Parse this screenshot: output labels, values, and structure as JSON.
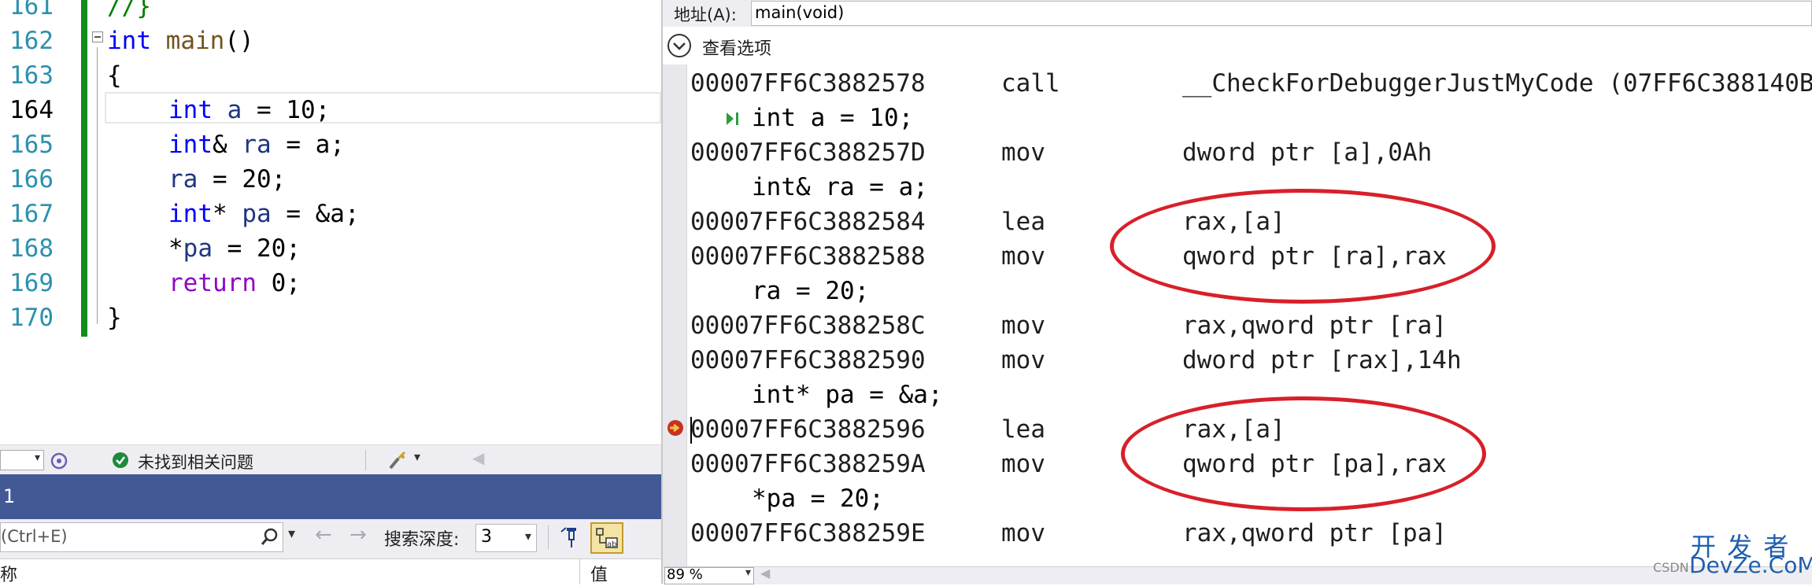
{
  "editor": {
    "line_numbers": [
      "161",
      "162",
      "163",
      "164",
      "165",
      "166",
      "167",
      "168",
      "169",
      "170"
    ],
    "current_line": "164",
    "lines": [
      {
        "comment": "//}"
      },
      {
        "kw": "int",
        "fn": " main",
        "rest": "()"
      },
      {
        "plain": "{"
      },
      {
        "kw": "int",
        "var": " a",
        "rest": " = 10;"
      },
      {
        "kw": "int",
        "rest1": "& ",
        "var": "ra",
        "rest": " = a;"
      },
      {
        "var": "ra",
        "rest": " = 20;"
      },
      {
        "kw": "int",
        "rest1": "* ",
        "var": "pa",
        "rest": " = &a;"
      },
      {
        "rest1": "*",
        "var": "pa",
        "rest": " = 20;"
      },
      {
        "kw2": "return",
        "rest": " 0;"
      },
      {
        "plain": "}"
      }
    ]
  },
  "status_bar": {
    "issues_text": "未找到相关问题"
  },
  "panel": {
    "title": "1",
    "search_placeholder": "(Ctrl+E)",
    "search_depth_label": "搜索深度:",
    "search_depth_value": "3",
    "col_name": "称",
    "col_value": "值"
  },
  "disassembly": {
    "address_label": "地址(A):",
    "address_value": "main(void)",
    "view_options": "查看选项",
    "zoom": "89 %",
    "rows": [
      {
        "type": "asm",
        "addr": "00007FF6C3882578",
        "op": "call",
        "arg": "__CheckForDebuggerJustMyCode (07FF6C388140B"
      },
      {
        "type": "src",
        "text": "int a = 10;"
      },
      {
        "type": "asm",
        "addr": "00007FF6C388257D",
        "op": "mov",
        "arg": "dword ptr [a],0Ah"
      },
      {
        "type": "src",
        "text": "int& ra = a;"
      },
      {
        "type": "asm",
        "addr": "00007FF6C3882584",
        "op": "lea",
        "arg": "rax,[a]"
      },
      {
        "type": "asm",
        "addr": "00007FF6C3882588",
        "op": "mov",
        "arg": "qword ptr [ra],rax"
      },
      {
        "type": "src",
        "text": "ra = 20;"
      },
      {
        "type": "asm",
        "addr": "00007FF6C388258C",
        "op": "mov",
        "arg": "rax,qword ptr [ra]"
      },
      {
        "type": "asm",
        "addr": "00007FF6C3882590",
        "op": "mov",
        "arg": "dword ptr [rax],14h"
      },
      {
        "type": "src",
        "text": "int* pa = &a;"
      },
      {
        "type": "asm",
        "addr": "00007FF6C3882596",
        "op": "lea",
        "arg": "rax,[a]"
      },
      {
        "type": "asm",
        "addr": "00007FF6C388259A",
        "op": "mov",
        "arg": "qword ptr [pa],rax"
      },
      {
        "type": "src",
        "text": "*pa = 20;"
      },
      {
        "type": "asm",
        "addr": "00007FF6C388259E",
        "op": "mov",
        "arg": "rax,qword ptr [pa]"
      }
    ]
  },
  "watermark": {
    "small": "CSDN",
    "cn": "开 发 者",
    "en": "DevZe.CoM"
  },
  "colors": {
    "change_bar": "#108d1c",
    "annotation_circle": "#d8202a",
    "panel_title_bg": "#425996",
    "watermark": "#1f5fae"
  }
}
